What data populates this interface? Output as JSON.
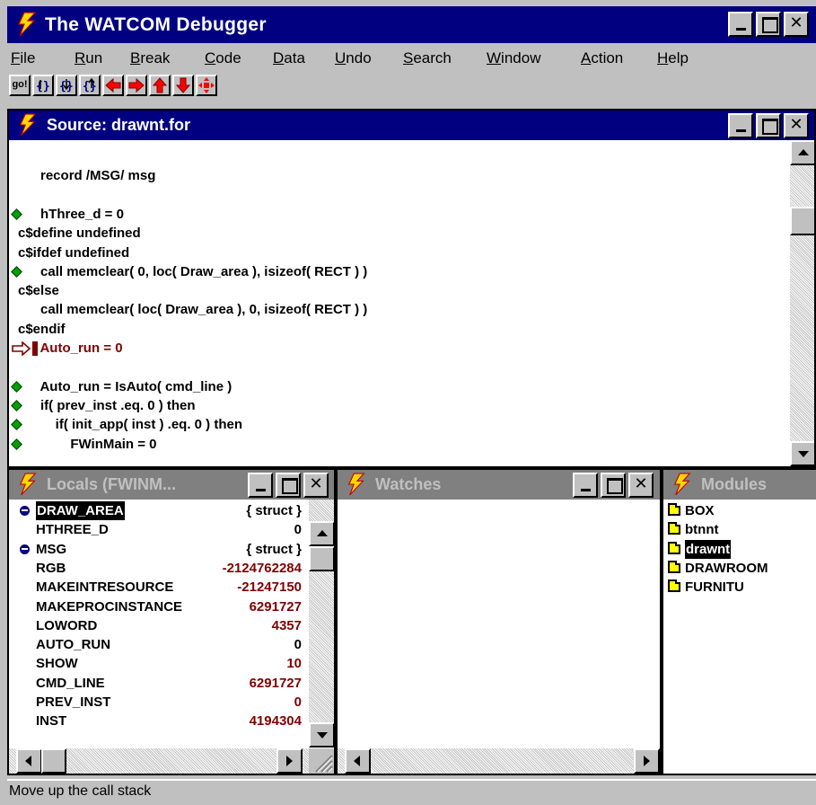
{
  "window": {
    "title": "The WATCOM Debugger"
  },
  "menubar": {
    "items": [
      {
        "label": "File",
        "key": "F",
        "rest": "ile"
      },
      {
        "label": "Run",
        "key": "R",
        "rest": "un"
      },
      {
        "label": "Break",
        "key": "B",
        "rest": "reak"
      },
      {
        "label": "Code",
        "key": "C",
        "rest": "ode"
      },
      {
        "label": "Data",
        "key": "D",
        "rest": "ata"
      },
      {
        "label": "Undo",
        "key": "U",
        "rest": "ndo"
      },
      {
        "label": "Search",
        "key": "S",
        "rest": "earch"
      },
      {
        "label": "Window",
        "key": "W",
        "rest": "indow"
      },
      {
        "label": "Action",
        "key": "A",
        "rest": "ction"
      },
      {
        "label": "Help",
        "key": "H",
        "rest": "elp"
      }
    ]
  },
  "toolbar": {
    "go_label": "go!",
    "buttons": [
      "go-icon",
      "trace-over-icon",
      "trace-into-icon",
      "return-icon",
      "back-arrow-icon",
      "forward-arrow-icon",
      "up-stack-icon",
      "down-stack-icon",
      "home-icon"
    ]
  },
  "source": {
    "title": "Source: drawnt.for",
    "lines": [
      {
        "text": "",
        "marker": ""
      },
      {
        "text": "      record /MSG/ msg",
        "marker": ""
      },
      {
        "text": "",
        "marker": ""
      },
      {
        "text": "      hThree_d = 0",
        "marker": "bp"
      },
      {
        "text": "c$define undefined",
        "marker": ""
      },
      {
        "text": "c$ifdef undefined",
        "marker": ""
      },
      {
        "text": "      call memclear( 0, loc( Draw_area ), isizeof( RECT ) )",
        "marker": "bp"
      },
      {
        "text": "c$else",
        "marker": ""
      },
      {
        "text": "      call memclear( loc( Draw_area ), 0, isizeof( RECT ) )",
        "marker": ""
      },
      {
        "text": "c$endif",
        "marker": ""
      },
      {
        "text": "      Auto_run = 0",
        "marker": "current"
      },
      {
        "text": "",
        "marker": ""
      },
      {
        "text": "      Auto_run = IsAuto( cmd_line )",
        "marker": "bp"
      },
      {
        "text": "      if( prev_inst .eq. 0 ) then",
        "marker": "bp"
      },
      {
        "text": "          if( init_app( inst ) .eq. 0 ) then",
        "marker": "bp"
      },
      {
        "text": "              FWinMain = 0",
        "marker": "bp"
      }
    ]
  },
  "locals": {
    "title": "Locals (FWINM...",
    "rows": [
      {
        "name": "DRAW_AREA",
        "value": "{ struct }",
        "expand": true,
        "selected": true,
        "black": true
      },
      {
        "name": "HTHREE_D",
        "value": "0",
        "expand": false,
        "selected": false,
        "black": true
      },
      {
        "name": "MSG",
        "value": "{ struct }",
        "expand": true,
        "selected": false,
        "black": true
      },
      {
        "name": "RGB",
        "value": "-2124762284",
        "expand": false,
        "selected": false,
        "black": false
      },
      {
        "name": "MAKEINTRESOURCE",
        "value": "-21247150",
        "expand": false,
        "selected": false,
        "black": false
      },
      {
        "name": "MAKEPROCINSTANCE",
        "value": "6291727",
        "expand": false,
        "selected": false,
        "black": false
      },
      {
        "name": "LOWORD",
        "value": "4357",
        "expand": false,
        "selected": false,
        "black": false
      },
      {
        "name": "AUTO_RUN",
        "value": "0",
        "expand": false,
        "selected": false,
        "black": true
      },
      {
        "name": "SHOW",
        "value": "10",
        "expand": false,
        "selected": false,
        "black": false
      },
      {
        "name": "CMD_LINE",
        "value": "6291727",
        "expand": false,
        "selected": false,
        "black": false
      },
      {
        "name": "PREV_INST",
        "value": "0",
        "expand": false,
        "selected": false,
        "black": false
      },
      {
        "name": "INST",
        "value": "4194304",
        "expand": false,
        "selected": false,
        "black": false
      }
    ]
  },
  "watches": {
    "title": "Watches"
  },
  "modules": {
    "title": "Modules",
    "items": [
      {
        "name": "BOX",
        "selected": false
      },
      {
        "name": "btnnt",
        "selected": false
      },
      {
        "name": "drawnt",
        "selected": true
      },
      {
        "name": "DRAWROOM",
        "selected": false
      },
      {
        "name": "FURNITU",
        "selected": false
      }
    ]
  },
  "status": {
    "text": "Move up the call stack"
  },
  "colors": {
    "title_active": "#000080",
    "title_inactive": "#808080",
    "face": "#c0c0c0",
    "value_red": "#800000",
    "breakpoint": "#00a000"
  }
}
